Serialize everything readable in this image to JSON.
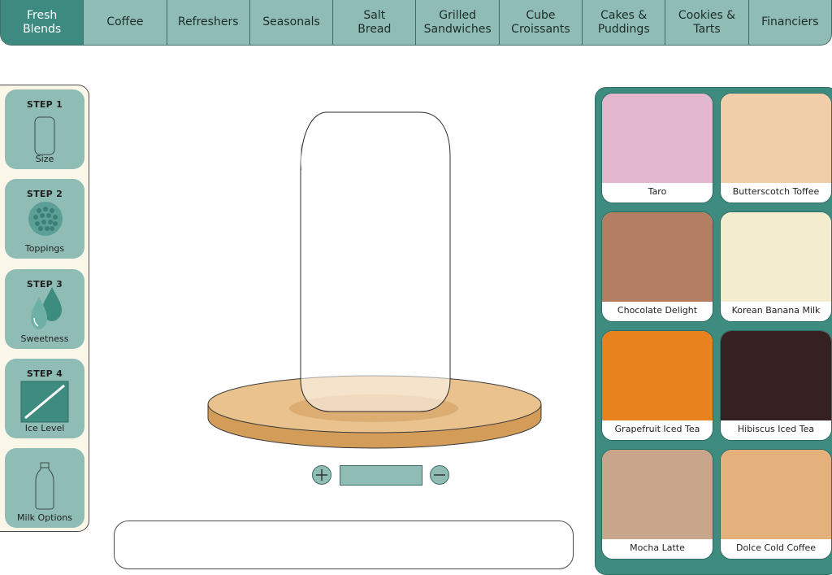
{
  "nav": {
    "items": [
      {
        "label": "Fresh\nBlends",
        "active": true
      },
      {
        "label": "Coffee"
      },
      {
        "label": "Refreshers"
      },
      {
        "label": "Seasonals"
      },
      {
        "label": "Salt\nBread"
      },
      {
        "label": "Grilled\nSandwiches"
      },
      {
        "label": "Cube\nCroissants"
      },
      {
        "label": "Cakes &\nPuddings"
      },
      {
        "label": "Cookies &\nTarts"
      },
      {
        "label": "Financiers"
      }
    ]
  },
  "steps": [
    {
      "title": "STEP 1",
      "label": "Size",
      "icon": "cup-icon"
    },
    {
      "title": "STEP 2",
      "label": "Toppings",
      "icon": "boba-icon"
    },
    {
      "title": "STEP 3",
      "label": "Sweetness",
      "icon": "drops-icon"
    },
    {
      "title": "STEP 4",
      "label": "Ice Level",
      "icon": "ice-icon"
    },
    {
      "title": "",
      "label": "Milk Options",
      "icon": "milk-bottle-icon"
    }
  ],
  "controls": {
    "increase_icon": "plus-icon",
    "decrease_icon": "minus-icon",
    "value": ""
  },
  "flavors": [
    {
      "name": "Taro",
      "color": "#e3b8ce"
    },
    {
      "name": "Butterscotch Toffee",
      "color": "#f0cea9"
    },
    {
      "name": "Chocolate Delight",
      "color": "#b37e62"
    },
    {
      "name": "Korean Banana Milk",
      "color": "#f3ecce"
    },
    {
      "name": "Grapefruit Iced Tea",
      "color": "#e7821f"
    },
    {
      "name": "Hibiscus Iced Tea",
      "color": "#362122"
    },
    {
      "name": "Mocha Latte",
      "color": "#c8a68c"
    },
    {
      "name": "Dolce Cold Coffee",
      "color": "#e4b07c"
    }
  ],
  "colors": {
    "accent": "#3d8a80",
    "panel_teal": "#8fbdb6",
    "cream": "#fbf7e8",
    "wood": "#e9c28e"
  }
}
